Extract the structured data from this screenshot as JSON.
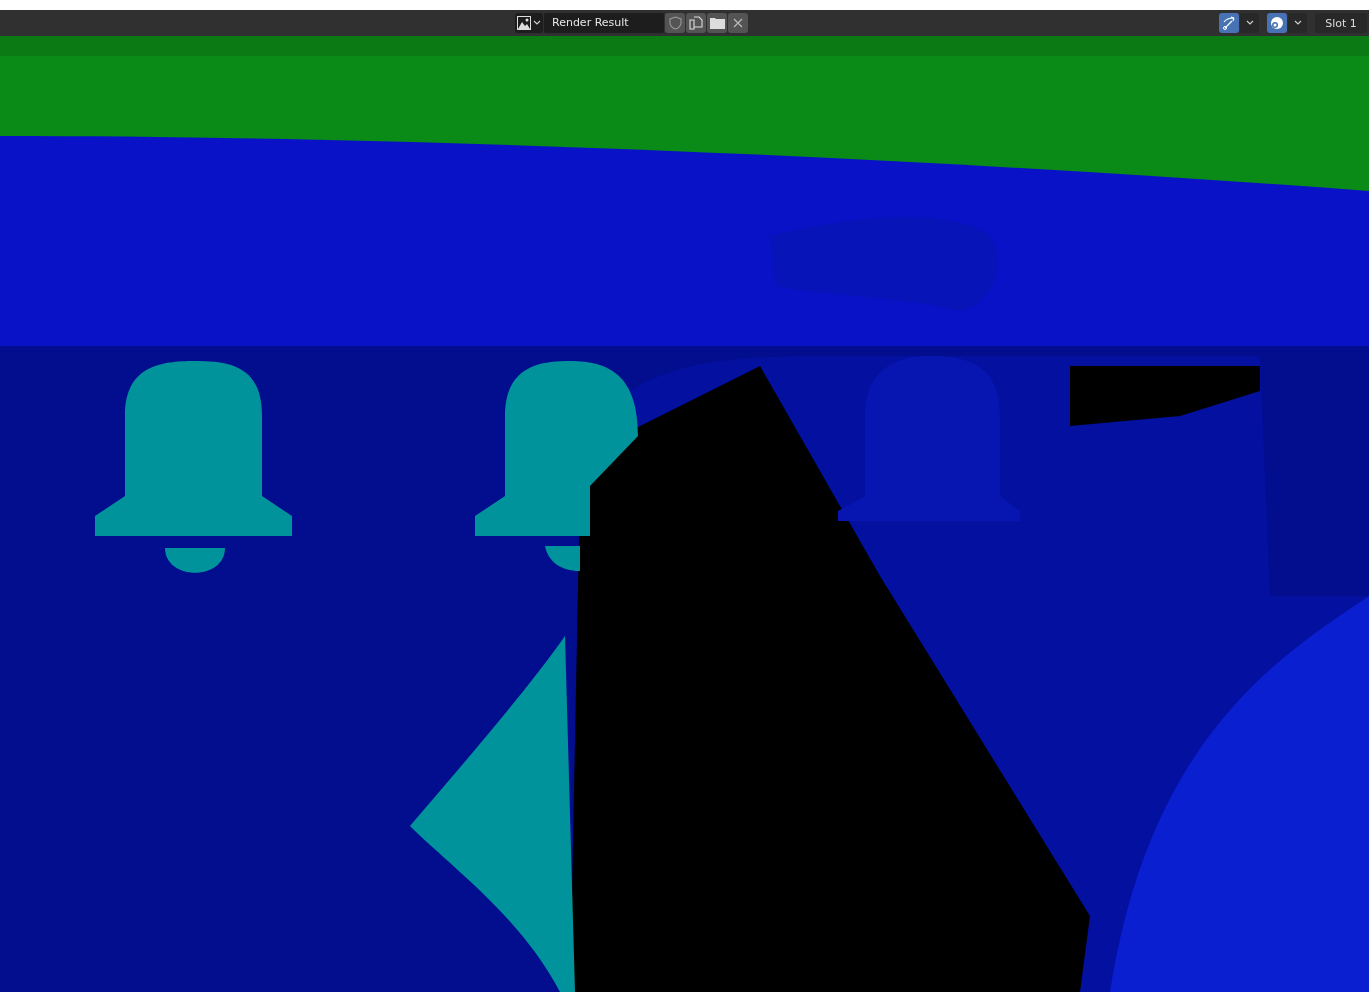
{
  "header": {
    "image_name": "Render Result",
    "fake_user": false,
    "toggles": [
      {
        "kind": "gizmo",
        "on": true
      },
      {
        "kind": "overlay",
        "on": true
      }
    ],
    "slot": "Slot 1"
  }
}
